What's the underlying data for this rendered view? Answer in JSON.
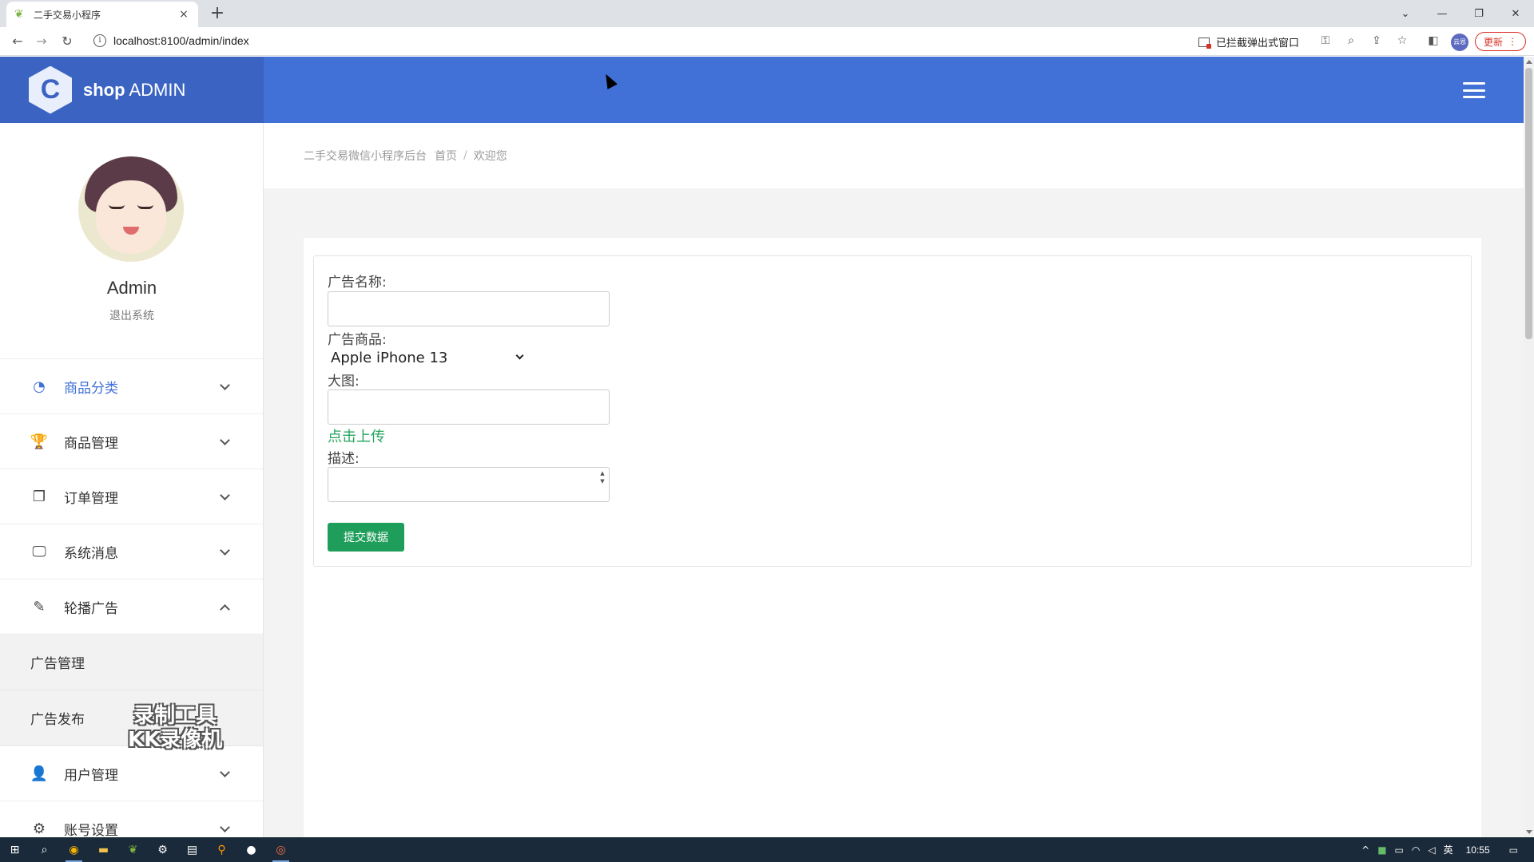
{
  "browser": {
    "tab_title": "二手交易小程序",
    "tab_close": "×",
    "new_tab": "+",
    "url": "localhost:8100/admin/index",
    "popup_blocked": "已拦截弹出式窗口",
    "profile_label": "云恩",
    "update_label": "更新",
    "update_more": "⋮",
    "minimize": "—",
    "restore": "❐",
    "close": "✕",
    "tab_list": "⌄"
  },
  "header": {
    "logo_mark": "C",
    "logo_bold": "shop",
    "logo_rest": " ADMIN"
  },
  "user": {
    "name": "Admin",
    "logout": "退出系统"
  },
  "menu": [
    {
      "label": "商品分类",
      "icon": "dashboard-icon",
      "glyph": "◔",
      "expanded": false,
      "active": true
    },
    {
      "label": "商品管理",
      "icon": "trophy-icon",
      "glyph": "🏆",
      "expanded": false,
      "active": false
    },
    {
      "label": "订单管理",
      "icon": "copy-icon",
      "glyph": "❐",
      "expanded": false,
      "active": false
    },
    {
      "label": "系统消息",
      "icon": "desktop-icon",
      "glyph": "🖵",
      "expanded": false,
      "active": false
    },
    {
      "label": "轮播广告",
      "icon": "edit-icon",
      "glyph": "✎",
      "expanded": true,
      "active": false
    },
    {
      "label": "广告管理"
    },
    {
      "label": "广告发布"
    },
    {
      "label": "用户管理",
      "icon": "user-icon",
      "glyph": "👤",
      "expanded": false,
      "active": false
    },
    {
      "label": "账号设置",
      "icon": "cogs-icon",
      "glyph": "⚙",
      "expanded": false,
      "active": false
    }
  ],
  "watermark": {
    "line1": "录制工具",
    "line2": "KK录像机"
  },
  "breadcrumb": {
    "brand": "二手交易微信小程序后台",
    "home": "首页",
    "separator": "/",
    "current": "欢迎您"
  },
  "form": {
    "ad_name_label": "广告名称:",
    "ad_name_value": "",
    "ad_product_label": "广告商品:",
    "ad_product_selected": "Apple iPhone 13",
    "image_label": "大图:",
    "image_value": "",
    "upload_link": "点击上传",
    "desc_label": "描述:",
    "desc_value": "",
    "submit_label": "提交数据"
  },
  "taskbar": {
    "ime": "英",
    "time": "10:55"
  },
  "colors": {
    "header_blue": "#4170d6",
    "logo_bg": "#3a63c2",
    "submit_green": "#1e9e5a",
    "upload_green": "#25a55f",
    "update_red": "#d93025"
  }
}
